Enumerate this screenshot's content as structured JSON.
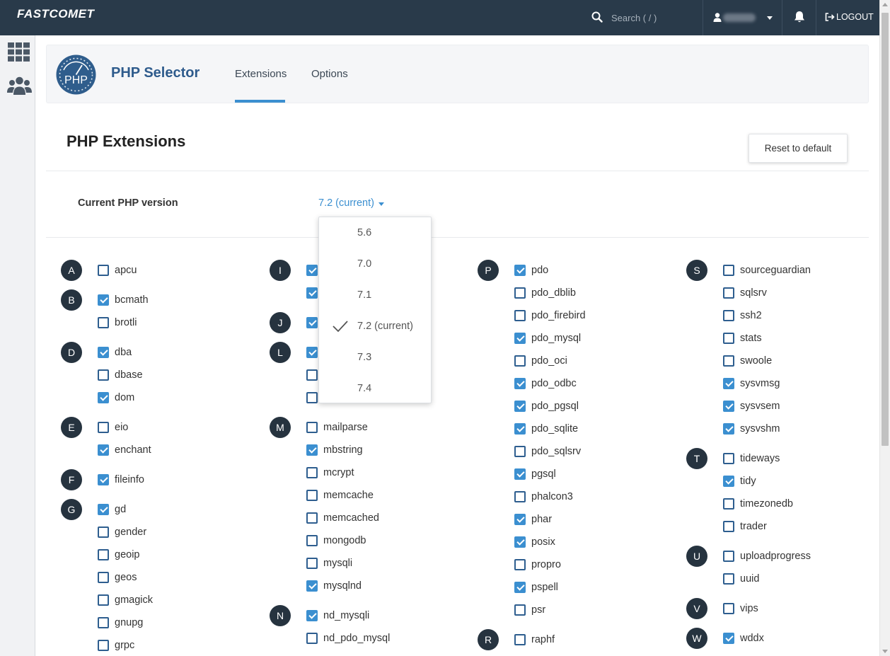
{
  "topbar": {
    "logo": "FASTCOMET",
    "search_placeholder": "Search ( / )",
    "logout_label": "LOGOUT"
  },
  "app": {
    "title": "PHP Selector",
    "logo_text": "PHP",
    "tabs": [
      {
        "label": "Extensions",
        "active": true
      },
      {
        "label": "Options",
        "active": false
      }
    ]
  },
  "section": {
    "title": "PHP Extensions",
    "reset_label": "Reset to default",
    "version_label": "Current PHP version",
    "version_value": "7.2 (current)"
  },
  "dropdown": {
    "options": [
      {
        "label": "5.6",
        "selected": false
      },
      {
        "label": "7.0",
        "selected": false
      },
      {
        "label": "7.1",
        "selected": false
      },
      {
        "label": "7.2 (current)",
        "selected": true
      },
      {
        "label": "7.3",
        "selected": false
      },
      {
        "label": "7.4",
        "selected": false
      }
    ]
  },
  "extensions": {
    "columns": [
      {
        "groups": [
          {
            "letter": "A",
            "items": [
              {
                "name": "apcu",
                "checked": false
              }
            ]
          },
          {
            "letter": "B",
            "items": [
              {
                "name": "bcmath",
                "checked": true
              },
              {
                "name": "brotli",
                "checked": false
              }
            ]
          },
          {
            "letter": "D",
            "items": [
              {
                "name": "dba",
                "checked": true
              },
              {
                "name": "dbase",
                "checked": false
              },
              {
                "name": "dom",
                "checked": true
              }
            ]
          },
          {
            "letter": "E",
            "items": [
              {
                "name": "eio",
                "checked": false
              },
              {
                "name": "enchant",
                "checked": true
              }
            ]
          },
          {
            "letter": "F",
            "items": [
              {
                "name": "fileinfo",
                "checked": true
              }
            ]
          },
          {
            "letter": "G",
            "items": [
              {
                "name": "gd",
                "checked": true
              },
              {
                "name": "gender",
                "checked": false
              },
              {
                "name": "geoip",
                "checked": false
              },
              {
                "name": "geos",
                "checked": false
              },
              {
                "name": "gmagick",
                "checked": false
              },
              {
                "name": "gnupg",
                "checked": false
              },
              {
                "name": "grpc",
                "checked": false
              }
            ]
          }
        ]
      },
      {
        "groups": [
          {
            "letter": "I",
            "items": [
              {
                "name": "",
                "checked": true
              },
              {
                "name": "",
                "checked": true
              }
            ]
          },
          {
            "letter": "J",
            "items": [
              {
                "name": "",
                "checked": true
              }
            ]
          },
          {
            "letter": "L",
            "items": [
              {
                "name": "",
                "checked": true
              },
              {
                "name": "",
                "checked": false
              },
              {
                "name": "",
                "checked": false
              }
            ]
          },
          {
            "letter": "M",
            "items": [
              {
                "name": "mailparse",
                "checked": false
              },
              {
                "name": "mbstring",
                "checked": true
              },
              {
                "name": "mcrypt",
                "checked": false
              },
              {
                "name": "memcache",
                "checked": false
              },
              {
                "name": "memcached",
                "checked": false
              },
              {
                "name": "mongodb",
                "checked": false
              },
              {
                "name": "mysqli",
                "checked": false
              },
              {
                "name": "mysqlnd",
                "checked": true
              }
            ]
          },
          {
            "letter": "N",
            "items": [
              {
                "name": "nd_mysqli",
                "checked": true
              },
              {
                "name": "nd_pdo_mysql",
                "checked": false
              }
            ]
          }
        ]
      },
      {
        "groups": [
          {
            "letter": "P",
            "items": [
              {
                "name": "pdo",
                "checked": true
              },
              {
                "name": "pdo_dblib",
                "checked": false
              },
              {
                "name": "pdo_firebird",
                "checked": false
              },
              {
                "name": "pdo_mysql",
                "checked": true
              },
              {
                "name": "pdo_oci",
                "checked": false
              },
              {
                "name": "pdo_odbc",
                "checked": true
              },
              {
                "name": "pdo_pgsql",
                "checked": true
              },
              {
                "name": "pdo_sqlite",
                "checked": true
              },
              {
                "name": "pdo_sqlsrv",
                "checked": false
              },
              {
                "name": "pgsql",
                "checked": true
              },
              {
                "name": "phalcon3",
                "checked": false
              },
              {
                "name": "phar",
                "checked": true
              },
              {
                "name": "posix",
                "checked": true
              },
              {
                "name": "propro",
                "checked": false
              },
              {
                "name": "pspell",
                "checked": true
              },
              {
                "name": "psr",
                "checked": false
              }
            ]
          },
          {
            "letter": "R",
            "items": [
              {
                "name": "raphf",
                "checked": false
              }
            ]
          }
        ]
      },
      {
        "groups": [
          {
            "letter": "S",
            "items": [
              {
                "name": "sourceguardian",
                "checked": false
              },
              {
                "name": "sqlsrv",
                "checked": false
              },
              {
                "name": "ssh2",
                "checked": false
              },
              {
                "name": "stats",
                "checked": false
              },
              {
                "name": "swoole",
                "checked": false
              },
              {
                "name": "sysvmsg",
                "checked": true
              },
              {
                "name": "sysvsem",
                "checked": true
              },
              {
                "name": "sysvshm",
                "checked": true
              }
            ]
          },
          {
            "letter": "T",
            "items": [
              {
                "name": "tideways",
                "checked": false
              },
              {
                "name": "tidy",
                "checked": true
              },
              {
                "name": "timezonedb",
                "checked": false
              },
              {
                "name": "trader",
                "checked": false
              }
            ]
          },
          {
            "letter": "U",
            "items": [
              {
                "name": "uploadprogress",
                "checked": false
              },
              {
                "name": "uuid",
                "checked": false
              }
            ]
          },
          {
            "letter": "V",
            "items": [
              {
                "name": "vips",
                "checked": false
              }
            ]
          },
          {
            "letter": "W",
            "items": [
              {
                "name": "wddx",
                "checked": true
              }
            ]
          }
        ]
      }
    ]
  }
}
